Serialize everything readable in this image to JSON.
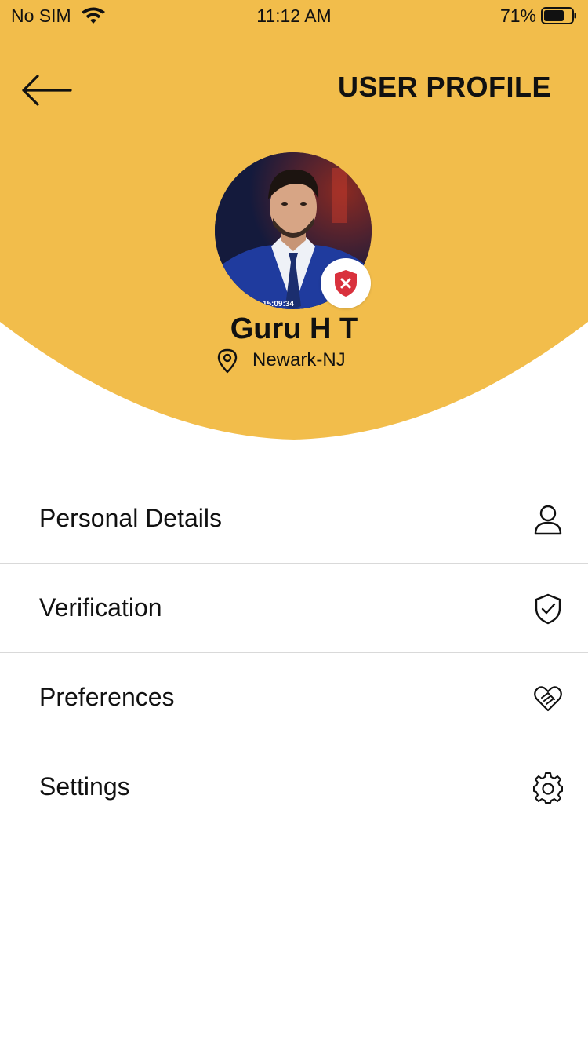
{
  "status_bar": {
    "carrier": "No SIM",
    "time": "11:12 AM",
    "battery_percent": "71%"
  },
  "header": {
    "title": "USER PROFILE",
    "back_icon": "arrow-left-icon",
    "background_color": "#F2BD4B"
  },
  "profile": {
    "name": "Guru H T",
    "location": "Newark-NJ",
    "photo_timestamp": "2-15:09:34",
    "verification_status": "not-verified",
    "badge_color": "#D9313D"
  },
  "menu": {
    "items": [
      {
        "label": "Personal Details",
        "icon": "person-icon"
      },
      {
        "label": "Verification",
        "icon": "shield-check-icon"
      },
      {
        "label": "Preferences",
        "icon": "handshake-heart-icon"
      },
      {
        "label": "Settings",
        "icon": "gear-icon"
      }
    ]
  }
}
